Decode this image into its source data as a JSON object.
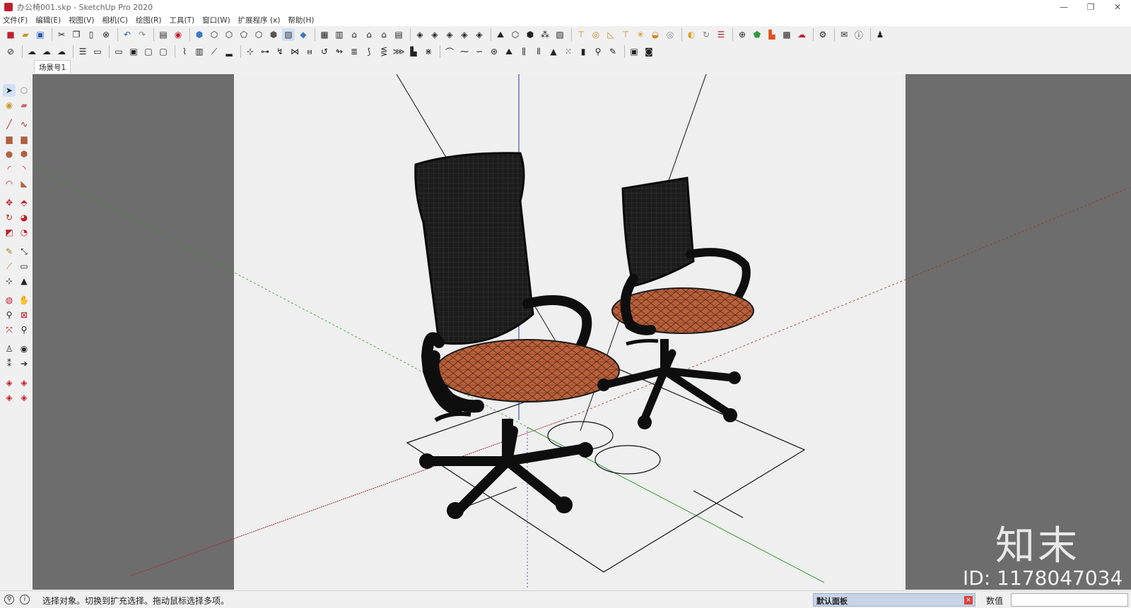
{
  "window": {
    "title": "办公椅001.skp - SketchUp Pro 2020",
    "minimize_glyph": "—",
    "restore_glyph": "❐",
    "close_glyph": "✕"
  },
  "menu": [
    "文件(F)",
    "编辑(E)",
    "视图(V)",
    "相机(C)",
    "绘图(R)",
    "工具(T)",
    "窗口(W)",
    "扩展程序 (x)",
    "帮助(H)"
  ],
  "scene_tab": "场景号1",
  "status": {
    "message": "选择对象。切换到扩充选择。拖动鼠标选择多项。",
    "tray_title": "默认面板",
    "measurement_label": "数值",
    "measurement_value": ""
  },
  "watermark": {
    "logo": "知末",
    "id": "ID: 1178047034"
  },
  "colors": {
    "seat": "#b8603c",
    "frame": "#1a1a1a",
    "viewport_bg": "#6d6d6d",
    "canvas": "#efefef"
  }
}
